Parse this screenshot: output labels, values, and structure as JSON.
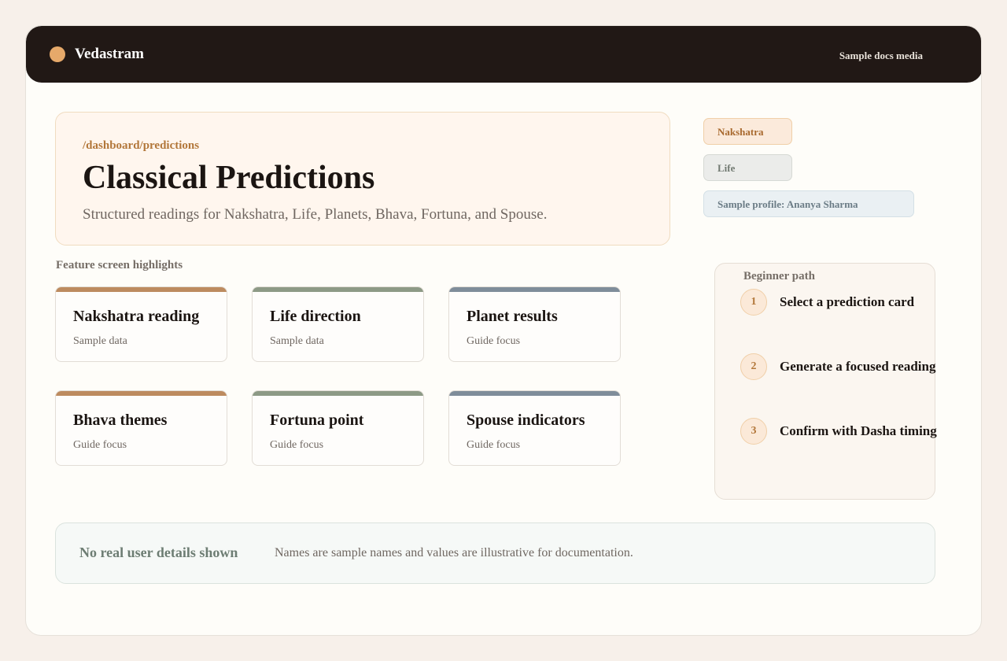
{
  "header": {
    "brand": "Vedastram",
    "link": "Sample docs media",
    "brand_color": "#e6a96a"
  },
  "hero": {
    "path": "/dashboard/predictions",
    "title": "Classical Predictions",
    "subtitle": "Structured readings for Nakshatra, Life, Planets, Bhava, Fortuna, and Spouse."
  },
  "chips": {
    "nakshatra": "Nakshatra",
    "life": "Life",
    "profile": "Sample profile: Ananya Sharma"
  },
  "highlights": {
    "label": "Feature screen highlights",
    "cards": [
      {
        "title": "Nakshatra reading",
        "subtitle": "Sample data",
        "accent": "#bd8b5f"
      },
      {
        "title": "Life direction",
        "subtitle": "Sample data",
        "accent": "#8d9a86"
      },
      {
        "title": "Planet results",
        "subtitle": "Guide focus",
        "accent": "#7f8d9a"
      },
      {
        "title": "Bhava themes",
        "subtitle": "Guide focus",
        "accent": "#bd8b5f"
      },
      {
        "title": "Fortuna point",
        "subtitle": "Guide focus",
        "accent": "#8d9a86"
      },
      {
        "title": "Spouse indicators",
        "subtitle": "Guide focus",
        "accent": "#7f8d9a"
      }
    ]
  },
  "beginner_path": {
    "label": "Beginner path",
    "steps": [
      {
        "number": "1",
        "text": "Select a prediction card"
      },
      {
        "number": "2",
        "text": "Generate a focused reading"
      },
      {
        "number": "3",
        "text": "Confirm with Dasha timing"
      }
    ]
  },
  "notice": {
    "title": "No real user details shown",
    "text": "Names are sample names and values are illustrative for documentation."
  }
}
